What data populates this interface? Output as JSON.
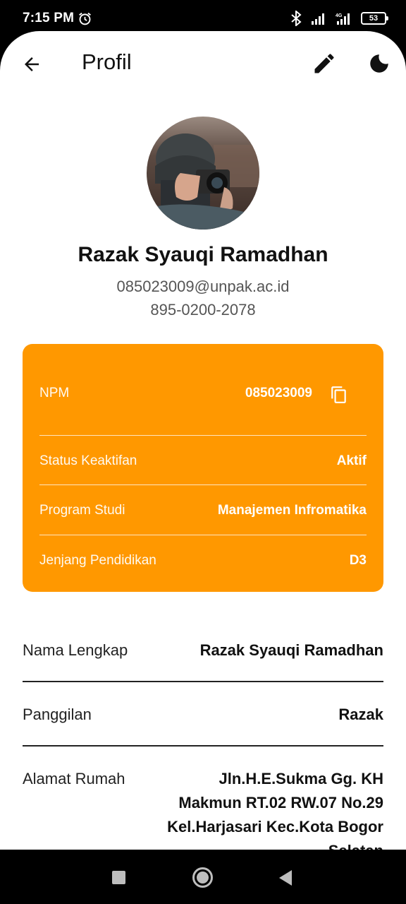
{
  "status_bar": {
    "time": "7:15 PM",
    "battery": "53",
    "icons": [
      "alarm-icon",
      "bluetooth-icon",
      "signal-icon",
      "4g-signal-icon",
      "battery-icon"
    ]
  },
  "app_bar": {
    "title": "Profil",
    "icons": [
      "arrow-back-icon",
      "pencil-icon",
      "moon-icon"
    ]
  },
  "profile": {
    "name": "Razak Syauqi Ramadhan",
    "email": "085023009@unpak.ac.id",
    "phone": "895-0200-2078"
  },
  "academic_card": {
    "accent": "#ff9800",
    "rows": [
      {
        "label": "NPM",
        "value": "085023009"
      },
      {
        "label": "Status Keaktifan",
        "value": "Aktif"
      },
      {
        "label": "Program Studi",
        "value": "Manajemen Infromatika"
      },
      {
        "label": "Jenjang Pendidikan",
        "value": "D3"
      }
    ]
  },
  "details": [
    {
      "label": "Nama Lengkap",
      "value": "Razak Syauqi Ramadhan"
    },
    {
      "label": "Panggilan",
      "value": "Razak"
    },
    {
      "label": "Alamat Rumah",
      "value_lines": [
        "Jln.H.E.Sukma Gg. KH",
        "Makmun RT.02 RW.07 No.29",
        "Kel.Harjasari Kec.Kota Bogor",
        "Selatan"
      ]
    }
  ],
  "nav_bar": {
    "icons": [
      "recent-apps-icon",
      "home-icon",
      "back-icon"
    ]
  }
}
